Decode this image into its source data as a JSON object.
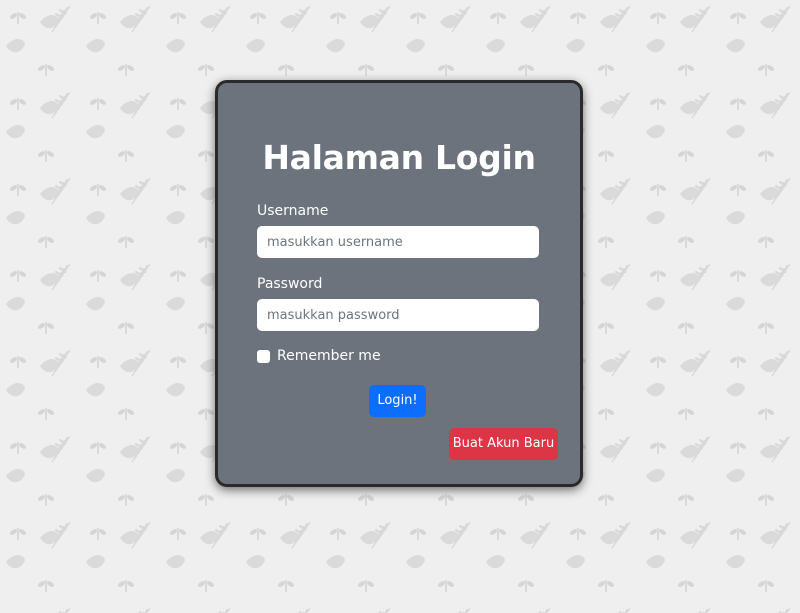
{
  "login": {
    "title": "Halaman Login",
    "username_label": "Username",
    "username_placeholder": "masukkan username",
    "password_label": "Password",
    "password_placeholder": "masukkan password",
    "remember_label": "Remember me",
    "login_button": "Login!",
    "register_button": "Buat Akun Baru"
  },
  "colors": {
    "page_background": "#efefef",
    "card_background": "#6c737c",
    "primary_button": "#0d6efd",
    "danger_button": "#dc3545"
  },
  "icons": {
    "background_pattern": "leaf-pattern"
  }
}
